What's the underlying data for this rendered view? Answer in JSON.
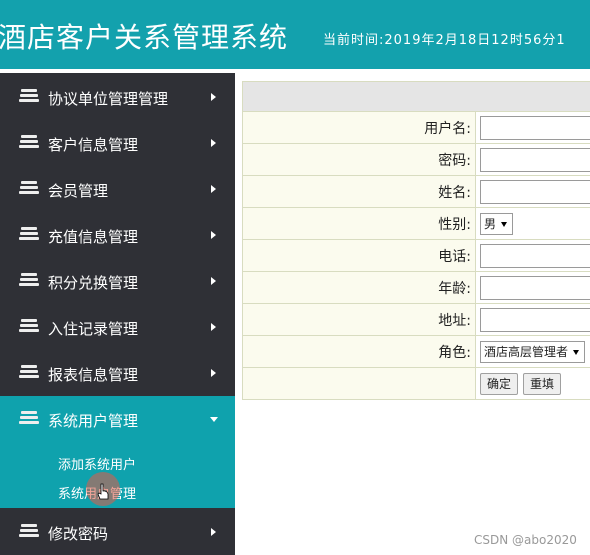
{
  "header": {
    "title": "酒店客户关系管理系统",
    "clock": "当前时间:2019年2月18日12时56分1"
  },
  "sidebar": {
    "items": [
      {
        "label": "协议单位管理管理",
        "expanded": false
      },
      {
        "label": "客户信息管理",
        "expanded": false
      },
      {
        "label": "会员管理",
        "expanded": false
      },
      {
        "label": "充值信息管理",
        "expanded": false
      },
      {
        "label": "积分兑换管理",
        "expanded": false
      },
      {
        "label": "入住记录管理",
        "expanded": false
      },
      {
        "label": "报表信息管理",
        "expanded": false
      },
      {
        "label": "系统用户管理",
        "expanded": true
      },
      {
        "label": "修改密码",
        "expanded": false
      }
    ],
    "submenu": [
      {
        "label": "添加系统用户"
      },
      {
        "label": "系统用户管理"
      }
    ]
  },
  "form": {
    "username_label": "用户名:",
    "username_value": "",
    "password_label": "密码:",
    "password_value": "",
    "name_label": "姓名:",
    "name_value": "",
    "gender_label": "性别:",
    "gender_value": "男",
    "phone_label": "电话:",
    "phone_value": "",
    "age_label": "年龄:",
    "age_value": "",
    "address_label": "地址:",
    "address_value": "",
    "role_label": "角色:",
    "role_value": "酒店高层管理者",
    "submit_label": "确定",
    "reset_label": "重填"
  },
  "watermark": "CSDN @abo2020",
  "colors": {
    "accent": "#13a1ad",
    "sidebar_bg": "#2f3036",
    "active_bg": "#0fa2ad",
    "label_cell_bg": "#fbfbee",
    "table_header_bg": "#e5e5e5"
  },
  "icons": {
    "nav": "stack-icon",
    "collapsed": "caret-right-icon",
    "expanded": "caret-down-icon",
    "pointer": "hand-pointer-icon"
  }
}
